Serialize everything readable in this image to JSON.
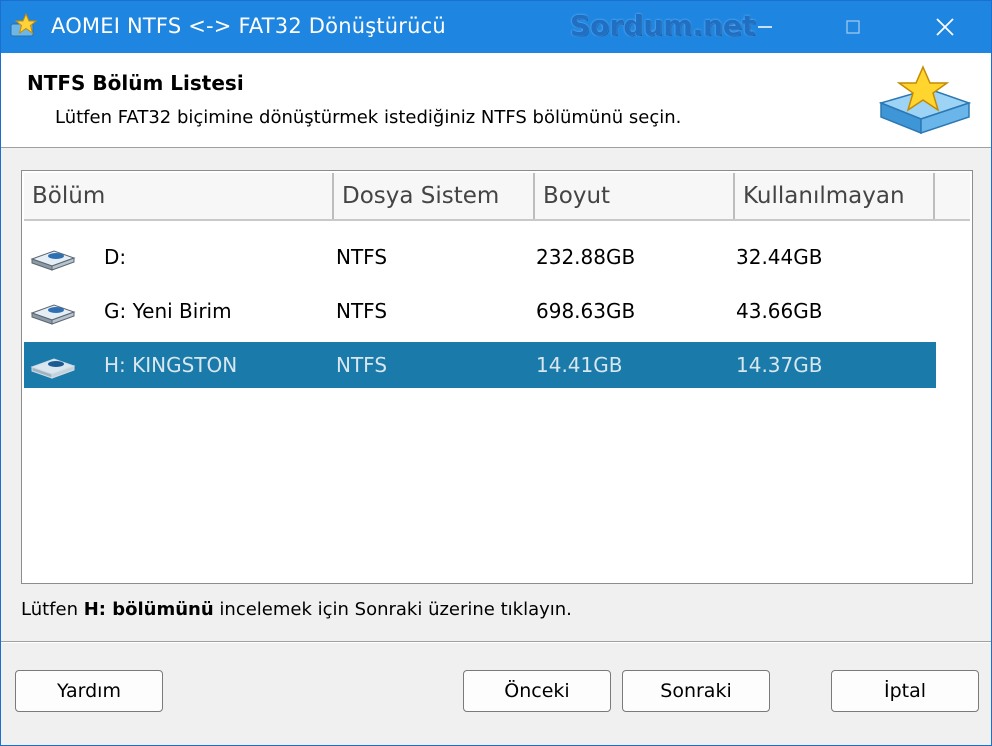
{
  "window": {
    "title": "AOMEI NTFS <-> FAT32 Dönüştürücü",
    "watermark": "Sordum.net",
    "minimize_label": "—",
    "maximize_label": "☐",
    "close_label": "✕"
  },
  "header": {
    "title": "NTFS Bölüm Listesi",
    "subtitle": "Lütfen FAT32 biçimine dönüştürmek istediğiniz NTFS bölümünü seçin."
  },
  "table": {
    "columns": [
      "Bölüm",
      "Dosya Sistem",
      "Boyut",
      "Kullanılmayan"
    ],
    "rows": [
      {
        "partition": "D:",
        "fs": "NTFS",
        "size": "232.88GB",
        "unused": "32.44GB",
        "selected": false
      },
      {
        "partition": "G: Yeni Birim",
        "fs": "NTFS",
        "size": "698.63GB",
        "unused": "43.66GB",
        "selected": false
      },
      {
        "partition": "H: KINGSTON",
        "fs": "NTFS",
        "size": "14.41GB",
        "unused": "14.37GB",
        "selected": true
      }
    ]
  },
  "status": {
    "prefix": "Lütfen ",
    "bold": "H: bölümünü",
    "suffix": " incelemek için Sonraki üzerine tıklayın."
  },
  "buttons": {
    "help": "Yardım",
    "back": "Önceki",
    "next": "Sonraki",
    "cancel": "İptal"
  },
  "colors": {
    "titlebar": "#1e86e0",
    "selection": "#1a7aa9"
  }
}
